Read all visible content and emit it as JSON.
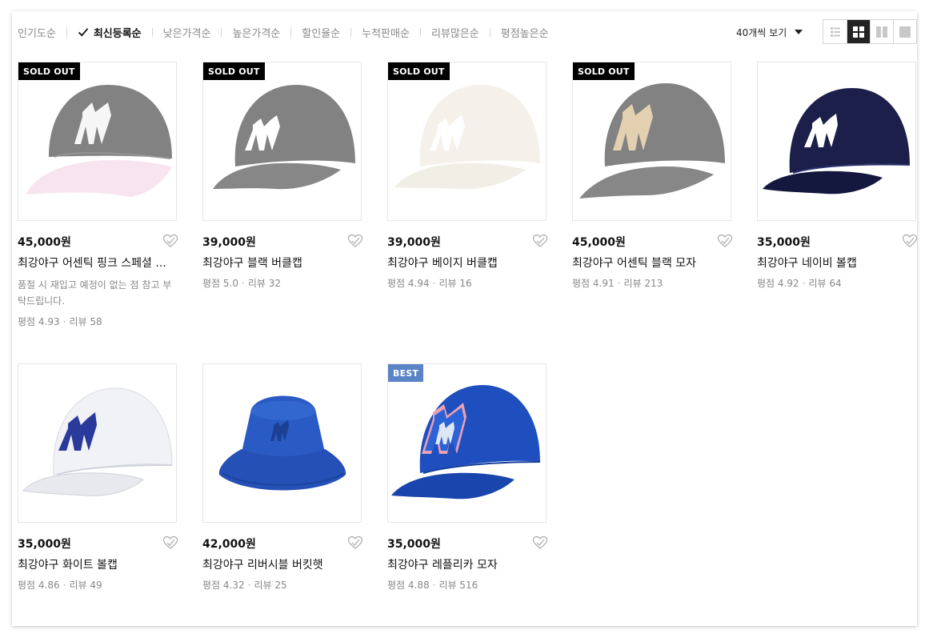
{
  "sort": {
    "items": [
      {
        "label": "인기도순",
        "active": false
      },
      {
        "label": "최신등록순",
        "active": true
      },
      {
        "label": "낮은가격순",
        "active": false
      },
      {
        "label": "높은가격순",
        "active": false
      },
      {
        "label": "할인율순",
        "active": false
      },
      {
        "label": "누적판매순",
        "active": false
      },
      {
        "label": "리뷰많은순",
        "active": false
      },
      {
        "label": "평점높은순",
        "active": false
      }
    ]
  },
  "view_count": {
    "label": "40개씩 보기"
  },
  "view_modes": [
    "list-view-icon",
    "grid-view-icon",
    "two-column-view-icon",
    "single-view-icon"
  ],
  "colors": {
    "sold_badge": "#000000",
    "best_badge": "#5b83c7"
  },
  "products": [
    {
      "badge": "SOLD OUT",
      "price": "45,000원",
      "name": "최강야구 어센틱 핑크 스페셜 ...",
      "notice": "품절 시 재입고 예정이 없는 점 참고 부탁드립니다.",
      "rating": "평점 4.93",
      "reviews": "리뷰 58",
      "image": "pink-baseball-cap"
    },
    {
      "badge": "SOLD OUT",
      "price": "39,000원",
      "name": "최강야구 블랙 버클캡",
      "notice": "",
      "rating": "평점 5.0",
      "reviews": "리뷰 32",
      "image": "black-buckle-cap"
    },
    {
      "badge": "SOLD OUT",
      "price": "39,000원",
      "name": "최강야구 베이지 버클캡",
      "notice": "",
      "rating": "평점 4.94",
      "reviews": "리뷰 16",
      "image": "beige-buckle-cap"
    },
    {
      "badge": "SOLD OUT",
      "price": "45,000원",
      "name": "최강야구 어센틱 블랙 모자",
      "notice": "",
      "rating": "평점 4.91",
      "reviews": "리뷰 213",
      "image": "black-authentic-cap"
    },
    {
      "badge": "",
      "price": "35,000원",
      "name": "최강야구 네이비 볼캡",
      "notice": "",
      "rating": "평점 4.92",
      "reviews": "리뷰 64",
      "image": "navy-ball-cap"
    },
    {
      "badge": "",
      "price": "35,000원",
      "name": "최강야구 화이트 볼캡",
      "notice": "",
      "rating": "평점 4.86",
      "reviews": "리뷰 49",
      "image": "white-ball-cap"
    },
    {
      "badge": "",
      "price": "42,000원",
      "name": "최강야구 리버시블 버킷햇",
      "notice": "",
      "rating": "평점 4.32",
      "reviews": "리뷰 25",
      "image": "reversible-bucket-hat"
    },
    {
      "badge": "BEST",
      "price": "35,000원",
      "name": "최강야구 레플리카 모자",
      "notice": "",
      "rating": "평점 4.88",
      "reviews": "리뷰 516",
      "image": "blue-replica-cap"
    }
  ]
}
